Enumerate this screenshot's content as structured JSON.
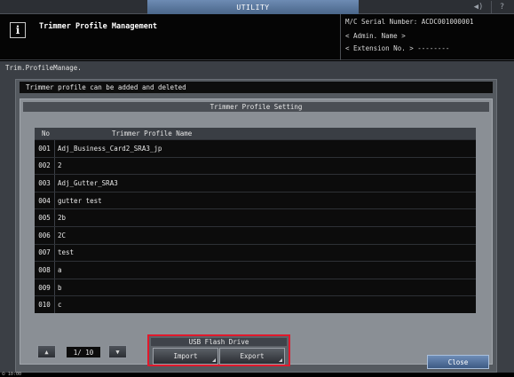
{
  "topbar": {
    "tab_label": "UTILITY",
    "sound_icon": "speaker-icon",
    "sound_label": "◀)",
    "help_label": "?"
  },
  "header": {
    "info_glyph": "i",
    "title": "Trimmer Profile Management",
    "serial": "M/C Serial Number: ACDC001000001",
    "admin": "< Admin. Name >",
    "extension": "< Extension No. >  --------"
  },
  "breadcrumb": "Trim.ProfileManage.",
  "message": "Trimmer profile can be added and deleted",
  "section_title": "Trimmer Profile Setting",
  "table": {
    "columns": [
      "No",
      "Trimmer Profile Name"
    ],
    "rows": [
      {
        "no": "001",
        "name": "Adj_Business_Card2_SRA3_jp"
      },
      {
        "no": "002",
        "name": "2"
      },
      {
        "no": "003",
        "name": "Adj_Gutter_SRA3"
      },
      {
        "no": "004",
        "name": "gutter test"
      },
      {
        "no": "005",
        "name": "2b"
      },
      {
        "no": "006",
        "name": "2C"
      },
      {
        "no": "007",
        "name": "test"
      },
      {
        "no": "008",
        "name": "a"
      },
      {
        "no": "009",
        "name": "b"
      },
      {
        "no": "010",
        "name": "c"
      }
    ]
  },
  "pager": {
    "up_glyph": "▲",
    "down_glyph": "▼",
    "display": "1/ 10"
  },
  "usb": {
    "title": "USB Flash Drive",
    "import_label": "Import",
    "export_label": "Export"
  },
  "close_label": "Close",
  "status": {
    "clock": "⏲ 10:00"
  },
  "colors": {
    "highlight_border": "#e0192c",
    "utility_tab": "#5a7aa2",
    "close_button": "#5a77a0"
  }
}
